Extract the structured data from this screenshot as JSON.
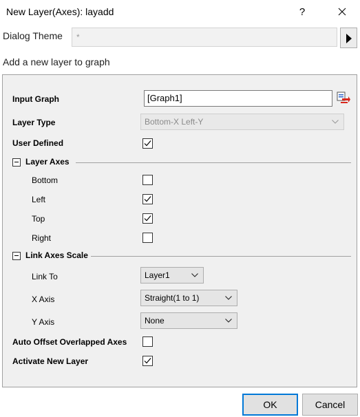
{
  "window": {
    "title": "New Layer(Axes): layadd"
  },
  "theme": {
    "label": "Dialog Theme",
    "value": "*"
  },
  "description": "Add a new layer to graph",
  "form": {
    "input_graph": {
      "label": "Input Graph",
      "value": "[Graph1]"
    },
    "layer_type": {
      "label": "Layer Type",
      "value": "Bottom-X Left-Y"
    },
    "user_defined": {
      "label": "User Defined",
      "checked": true
    },
    "layer_axes": {
      "title": "Layer Axes",
      "bottom": {
        "label": "Bottom",
        "checked": false
      },
      "left": {
        "label": "Left",
        "checked": true
      },
      "top": {
        "label": "Top",
        "checked": true
      },
      "right": {
        "label": "Right",
        "checked": false
      }
    },
    "link_axes_scale": {
      "title": "Link Axes Scale",
      "link_to": {
        "label": "Link To",
        "value": "Layer1"
      },
      "x_axis": {
        "label": "X Axis",
        "value": "Straight(1 to 1)"
      },
      "y_axis": {
        "label": "Y Axis",
        "value": "None"
      }
    },
    "auto_offset": {
      "label": "Auto Offset Overlapped Axes",
      "checked": false
    },
    "activate_new_layer": {
      "label": "Activate New Layer",
      "checked": true
    }
  },
  "buttons": {
    "ok": "OK",
    "cancel": "Cancel"
  },
  "colors": {
    "accent": "#0078d7",
    "panel": "#f0f0f0",
    "pick_icon_red": "#d9261c"
  }
}
